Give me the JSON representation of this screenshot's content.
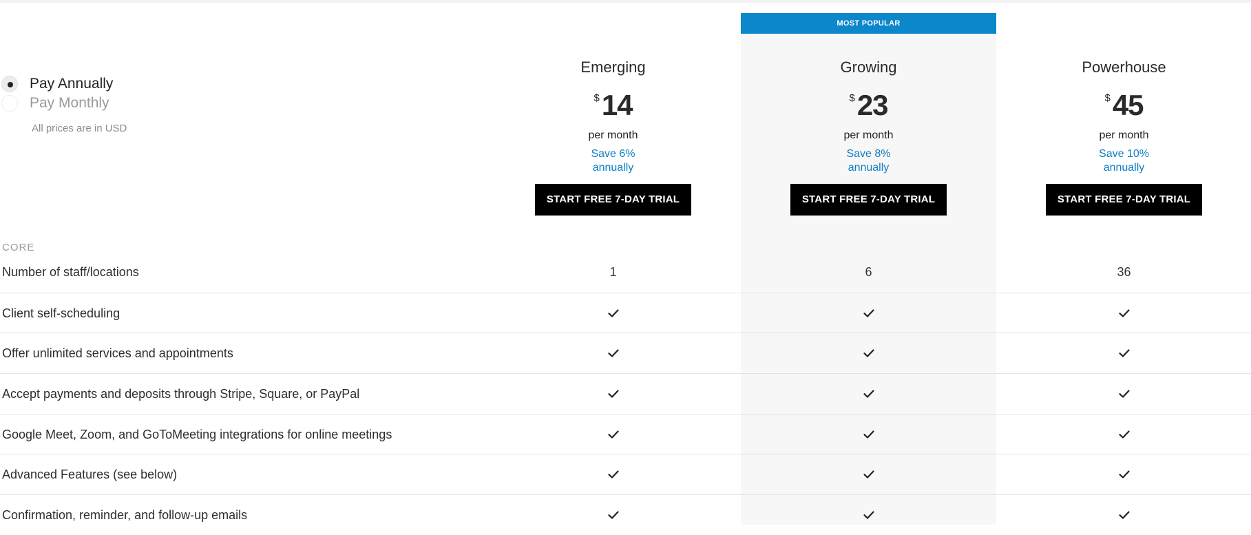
{
  "billing": {
    "annual_label": "Pay Annually",
    "monthly_label": "Pay Monthly",
    "selected": "annual",
    "currency_note": "All prices are in USD"
  },
  "popular_badge": "MOST POPULAR",
  "plans": [
    {
      "name": "Emerging",
      "currency": "$",
      "price": "14",
      "period": "per month",
      "save_line1": "Save 6%",
      "save_line2": "annually",
      "cta": "START FREE 7-DAY TRIAL"
    },
    {
      "name": "Growing",
      "currency": "$",
      "price": "23",
      "period": "per month",
      "save_line1": "Save 8%",
      "save_line2": "annually",
      "cta": "START FREE 7-DAY TRIAL",
      "popular": true
    },
    {
      "name": "Powerhouse",
      "currency": "$",
      "price": "45",
      "period": "per month",
      "save_line1": "Save 10%",
      "save_line2": "annually",
      "cta": "START FREE 7-DAY TRIAL"
    }
  ],
  "sections": [
    {
      "title": "CORE",
      "rows": [
        {
          "label": "Number of staff/locations",
          "values": [
            "1",
            "6",
            "36"
          ]
        },
        {
          "label": "Client self-scheduling",
          "values": [
            "check-icon",
            "check-icon",
            "check-icon"
          ]
        },
        {
          "label": "Offer unlimited services and appointments",
          "values": [
            "check-icon",
            "check-icon",
            "check-icon"
          ]
        },
        {
          "label": "Accept payments and deposits through Stripe, Square, or PayPal",
          "values": [
            "check-icon",
            "check-icon",
            "check-icon"
          ]
        },
        {
          "label": "Google Meet, Zoom, and GoToMeeting integrations for online meetings",
          "values": [
            "check-icon",
            "check-icon",
            "check-icon"
          ]
        },
        {
          "label": "Advanced Features (see below)",
          "values": [
            "check-icon",
            "check-icon",
            "check-icon"
          ]
        },
        {
          "label": "Confirmation, reminder, and follow-up emails",
          "values": [
            "check-icon",
            "check-icon",
            "check-icon"
          ]
        }
      ]
    }
  ],
  "colors": {
    "accent": "#0d87cb",
    "save_text": "#0d7ec2",
    "cta_bg": "#000000",
    "popular_column_bg": "#f7f7f7"
  }
}
